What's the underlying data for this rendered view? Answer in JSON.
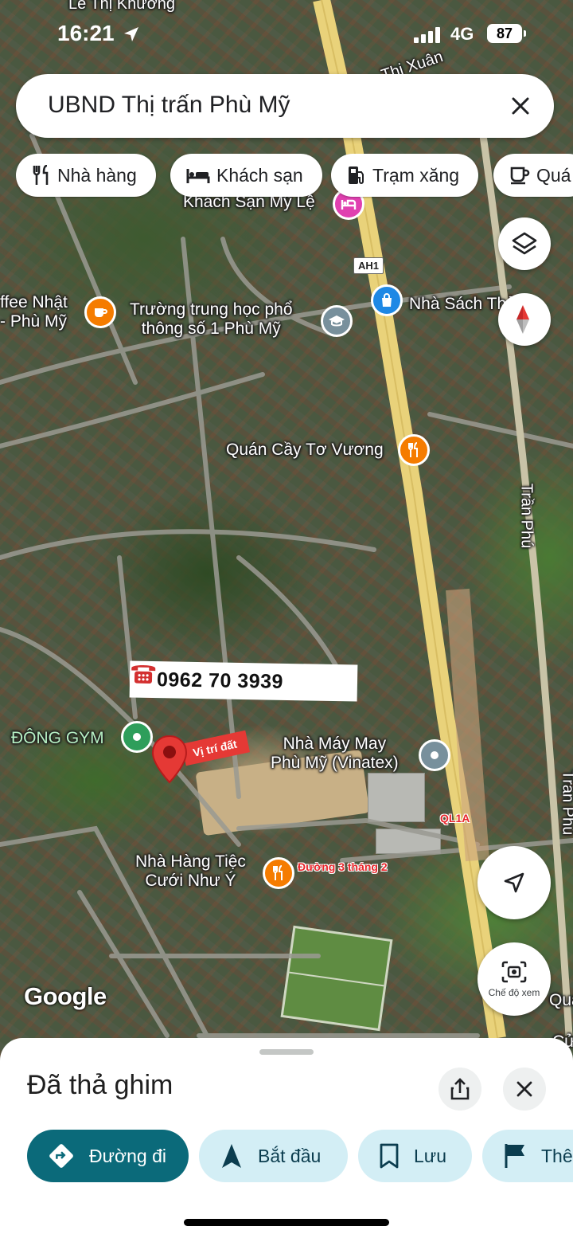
{
  "status_bar": {
    "time": "16:21",
    "network": "4G",
    "battery": "87"
  },
  "search": {
    "query": "UBND Thị trấn Phù Mỹ"
  },
  "chips": [
    {
      "label": "Nhà hàng",
      "icon": "restaurant-icon"
    },
    {
      "label": "Khách sạn",
      "icon": "hotel-icon"
    },
    {
      "label": "Trạm xăng",
      "icon": "gas-station-icon"
    },
    {
      "label": "Quá",
      "icon": "coffee-icon"
    }
  ],
  "map": {
    "labels": {
      "le_thi_khuong": "Lê Thị Khương",
      "thi_xuan": "Thị Xuân",
      "khach_san": "Khách Sạn Mỹ Lệ",
      "ah1": "AH1",
      "coffee_line1": "ffee Nhật",
      "coffee_line2": "- Phù Mỹ",
      "school_line1": "Trường trung học phổ",
      "school_line2": "thông số 1 Phù Mỹ",
      "bookstore": "Nhà Sách Thảo",
      "quan_cay": "Quán Cầy Tơ Vương",
      "tran_phu_1": "Trần Phú",
      "tran_phu_2": "Trần Phú",
      "dong_gym": "ĐÔNG GYM",
      "factory_line1": "Nhà Máy May",
      "factory_line2": "Phù Mỹ (Vinatex)",
      "ql1a": "QL1A",
      "duong_3_2": "Đường 3 tháng 2",
      "wedding_line1": "Nhà Hàng Tiệc",
      "wedding_line2": "Cưới Như Ý",
      "quan_edge": "Quán",
      "cua_edge": "Cửa"
    },
    "phone": "0962 70 3939",
    "lot_tag": "Vị trí đất",
    "google": "Google"
  },
  "view_mode_label": "Chế độ xem",
  "sheet": {
    "title": "Đã thả ghim",
    "actions": [
      {
        "label": "Đường đi",
        "icon": "directions-icon"
      },
      {
        "label": "Bắt đầu",
        "icon": "navigation-icon"
      },
      {
        "label": "Lưu",
        "icon": "bookmark-icon"
      },
      {
        "label": "Thê",
        "icon": "flag-icon"
      }
    ]
  },
  "colors": {
    "accent": "#0b6a7a",
    "action_bg": "#d3eef5",
    "pin_red": "#e53935",
    "road_yellow": "#e9d27a"
  }
}
